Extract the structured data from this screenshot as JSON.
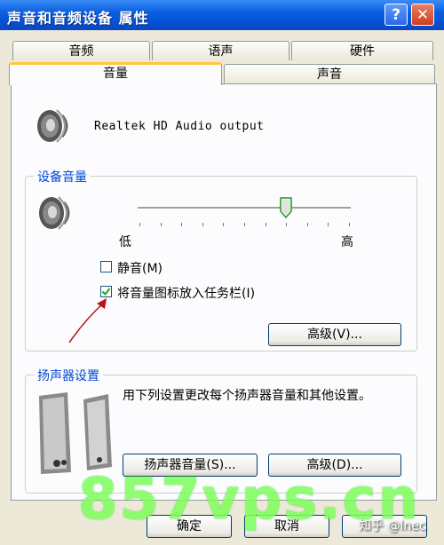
{
  "window": {
    "title": "声音和音频设备 属性"
  },
  "titlebar_buttons": {
    "help": "?",
    "close": "✕"
  },
  "tabs_back": [
    "音频",
    "语声",
    "硬件"
  ],
  "tabs_front": [
    "音量",
    "声音"
  ],
  "active_tab": "音量",
  "device": {
    "name": "Realtek HD Audio output",
    "icon": "speaker-icon"
  },
  "device_volume": {
    "label": "设备音量",
    "low_label": "低",
    "high_label": "高",
    "level_fraction": 0.7,
    "mute": {
      "label": "静音(M)",
      "checked": false
    },
    "tray_icon": {
      "label": "将音量图标放入任务栏(I)",
      "checked": true
    },
    "advanced_button": "高级(V)..."
  },
  "speaker_settings": {
    "label": "扬声器设置",
    "description": "用下列设置更改每个扬声器音量和其他设置。",
    "speaker_volume_button": "扬声器音量(S)...",
    "advanced_button": "高级(D)..."
  },
  "footer": {
    "ok": "确定",
    "cancel": "取消"
  },
  "watermark": "857vps.cn",
  "source_credit": "知乎 @lnec",
  "colors": {
    "accent": "#0a5fe0",
    "tab_highlight": "#ffc83c",
    "watermark": "#7dff5a"
  }
}
